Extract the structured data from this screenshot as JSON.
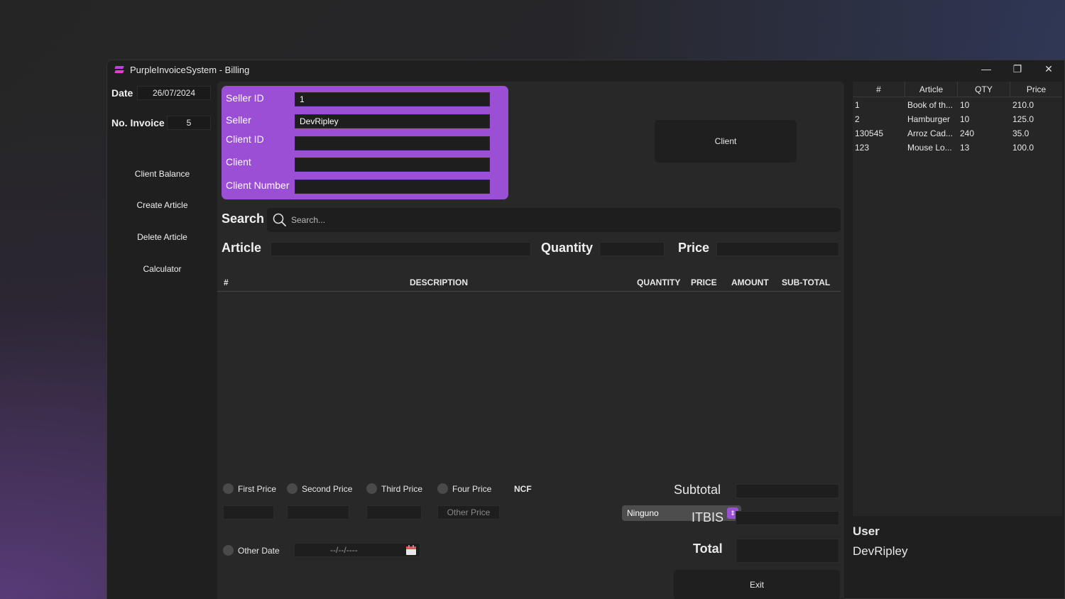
{
  "window": {
    "title": "PurpleInvoiceSystem - Billing",
    "controls": {
      "minimize": "—",
      "restore": "❐",
      "close": "✕"
    }
  },
  "left": {
    "date_label": "Date",
    "date_value": "26/07/2024",
    "invoice_label": "No. Invoice",
    "invoice_value": "5",
    "nav": [
      "Client Balance",
      "Create Article",
      "Delete Article",
      "Calculator"
    ]
  },
  "seller_box": {
    "seller_id_label": "Seller ID",
    "seller_id_value": "1",
    "seller_label": "Seller",
    "seller_value": "DevRipley",
    "client_id_label": "Client ID",
    "client_id_value": "",
    "client_label": "Client",
    "client_value": "",
    "client_number_label": "Client Number",
    "client_number_value": ""
  },
  "client_button": "Client",
  "search": {
    "label": "Search",
    "placeholder": "Search..."
  },
  "article_row": {
    "article_label": "Article",
    "quantity_label": "Quantity",
    "price_label": "Price"
  },
  "table_headers": {
    "num": "#",
    "description": "DESCRIPTION",
    "quantity": "QUANTITY",
    "price": "PRICE",
    "amount": "AMOUNT",
    "subtotal": "SUB-TOTAL"
  },
  "prices": {
    "first": "First Price",
    "second": "Second Price",
    "third": "Third Price",
    "four": "Four Price",
    "ncf": "NCF",
    "other_price_placeholder": "Other Price",
    "ncf_selected": "Ninguno"
  },
  "other_date": {
    "label": "Other Date",
    "placeholder": "--/--/----"
  },
  "totals": {
    "subtotal": "Subtotal",
    "itbis": "ITBIS",
    "total": "Total"
  },
  "exit_button": "Exit",
  "articles_table": {
    "headers": [
      "#",
      "Article",
      "QTY",
      "Price"
    ],
    "rows": [
      [
        "1",
        "Book of th...",
        "10",
        "210.0"
      ],
      [
        "2",
        "Hamburger",
        "10",
        "125.0"
      ],
      [
        "130545",
        "Arroz Cad...",
        "240",
        "35.0"
      ],
      [
        "123",
        "Mouse Lo...",
        "13",
        "100.0"
      ]
    ]
  },
  "user": {
    "label": "User",
    "name": "DevRipley"
  },
  "colors": {
    "accent": "#9b4fd4",
    "background": "#1f1f1f"
  }
}
